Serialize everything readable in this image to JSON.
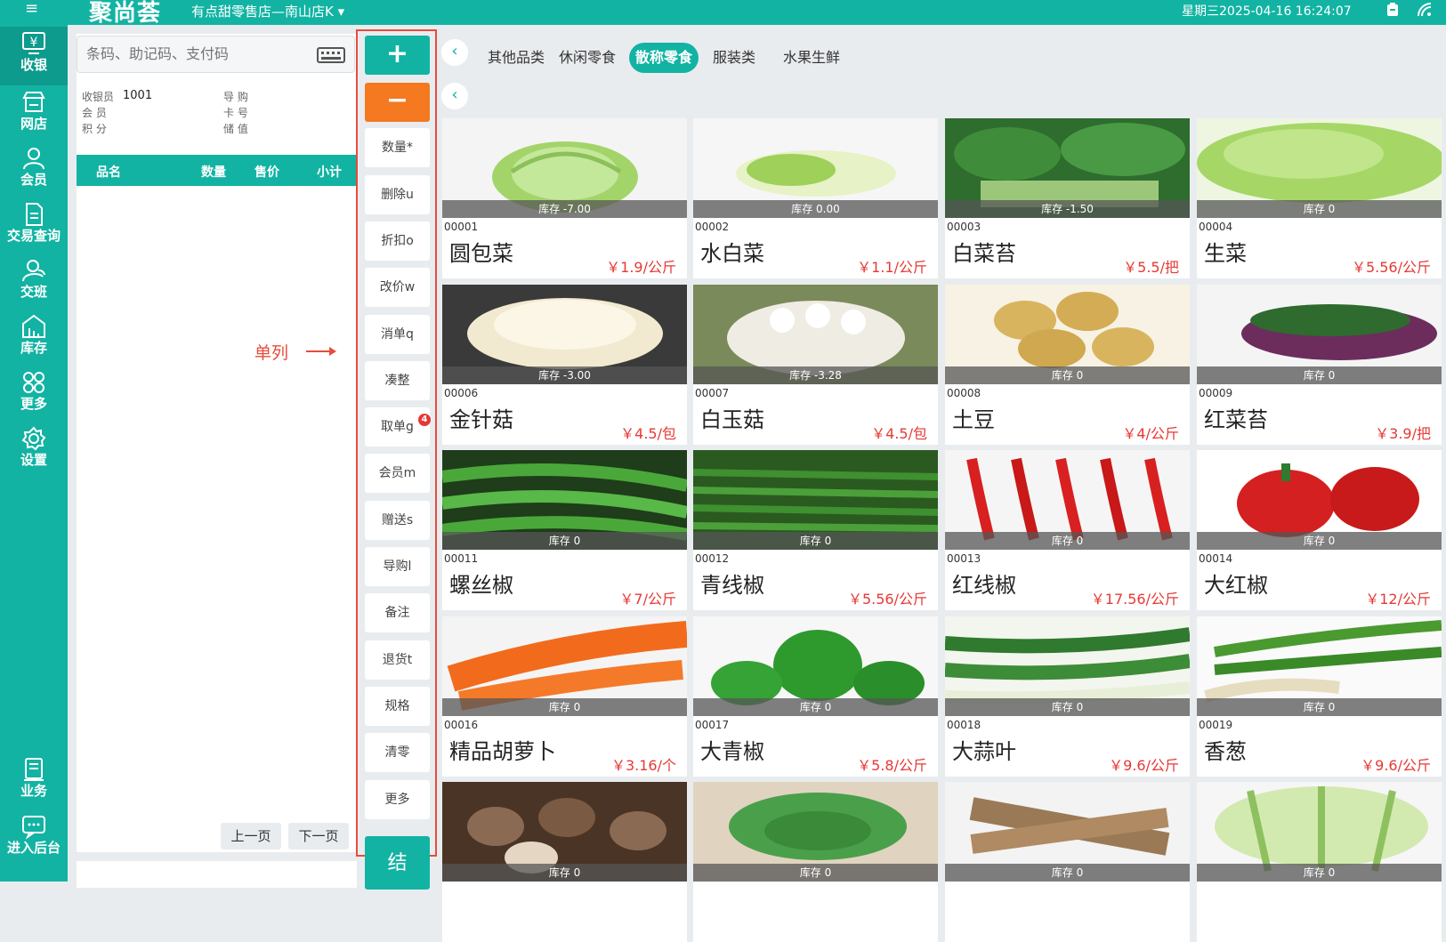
{
  "topbar": {
    "logo": "聚尚荟",
    "store": "有点甜零售店—南山店K",
    "datetime": "星期三2025-04-16 16:24:07"
  },
  "sidebar": {
    "items": [
      {
        "label": "收银",
        "icon": "cash-register-icon",
        "active": true
      },
      {
        "label": "网店",
        "icon": "shop-icon"
      },
      {
        "label": "会员",
        "icon": "member-icon"
      },
      {
        "label": "交易查询",
        "icon": "document-icon"
      },
      {
        "label": "交班",
        "icon": "shift-icon"
      },
      {
        "label": "库存",
        "icon": "warehouse-icon"
      },
      {
        "label": "更多",
        "icon": "grid-icon"
      },
      {
        "label": "设置",
        "icon": "gear-icon"
      },
      {
        "label": "业务",
        "icon": "book-icon"
      },
      {
        "label": "进入后台",
        "icon": "chat-icon"
      }
    ]
  },
  "search": {
    "placeholder": "条码、助记码、支付码"
  },
  "info": {
    "cashier_label": "收银员",
    "cashier_value": "1001",
    "member_label": "会 员",
    "points_label": "积 分",
    "guide_label": "导 购",
    "card_label": "卡 号",
    "stored_label": "储 值"
  },
  "table": {
    "headers": [
      "品名",
      "数量",
      "售价",
      "小计"
    ]
  },
  "pager": {
    "prev": "上一页",
    "next": "下一页"
  },
  "ops": {
    "plus": "+",
    "minus": "−",
    "buttons": [
      "数量*",
      "删除u",
      "折扣o",
      "改价w",
      "消单q",
      "凑整",
      "取单g",
      "会员m",
      "赠送s",
      "导购l",
      "备注",
      "退货t",
      "规格",
      "清零",
      "更多"
    ],
    "badge": "4",
    "checkout": "结"
  },
  "annotation": {
    "label": "单列"
  },
  "categories": [
    {
      "label": "其他品类"
    },
    {
      "label": "休闲零食"
    },
    {
      "label": "散称零食",
      "active": true
    },
    {
      "label": "服装类"
    },
    {
      "label": "水果生鲜"
    }
  ],
  "products": [
    {
      "code": "00001",
      "name": "圆包菜",
      "price": "￥1.9/公斤",
      "stock": "库存 -7.00"
    },
    {
      "code": "00002",
      "name": "水白菜",
      "price": "￥1.1/公斤",
      "stock": "库存 0.00"
    },
    {
      "code": "00003",
      "name": "白菜苔",
      "price": "￥5.5/把",
      "stock": "库存 -1.50"
    },
    {
      "code": "00004",
      "name": "生菜",
      "price": "￥5.56/公斤",
      "stock": "库存 0"
    },
    {
      "code": "00006",
      "name": "金针菇",
      "price": "￥4.5/包",
      "stock": "库存 -3.00"
    },
    {
      "code": "00007",
      "name": "白玉菇",
      "price": "￥4.5/包",
      "stock": "库存 -3.28"
    },
    {
      "code": "00008",
      "name": "土豆",
      "price": "￥4/公斤",
      "stock": "库存 0"
    },
    {
      "code": "00009",
      "name": "红菜苔",
      "price": "￥3.9/把",
      "stock": "库存 0"
    },
    {
      "code": "00011",
      "name": "螺丝椒",
      "price": "￥7/公斤",
      "stock": "库存 0"
    },
    {
      "code": "00012",
      "name": "青线椒",
      "price": "￥5.56/公斤",
      "stock": "库存 0"
    },
    {
      "code": "00013",
      "name": "红线椒",
      "price": "￥17.56/公斤",
      "stock": "库存 0"
    },
    {
      "code": "00014",
      "name": "大红椒",
      "price": "￥12/公斤",
      "stock": "库存 0"
    },
    {
      "code": "00016",
      "name": "精品胡萝卜",
      "price": "￥3.16/个",
      "stock": "库存 0"
    },
    {
      "code": "00017",
      "name": "大青椒",
      "price": "￥5.8/公斤",
      "stock": "库存 0"
    },
    {
      "code": "00018",
      "name": "大蒜叶",
      "price": "￥9.6/公斤",
      "stock": "库存 0"
    },
    {
      "code": "00019",
      "name": "香葱",
      "price": "￥9.6/公斤",
      "stock": "库存 0"
    },
    {
      "stock": "库存 0"
    },
    {
      "stock": "库存 0"
    },
    {
      "stock": "库存 0"
    },
    {
      "stock": "库存 0"
    }
  ],
  "colors": {
    "accent": "#12b3a3",
    "orange": "#f47920",
    "price": "#e53935",
    "annotation": "#e74c3c"
  }
}
